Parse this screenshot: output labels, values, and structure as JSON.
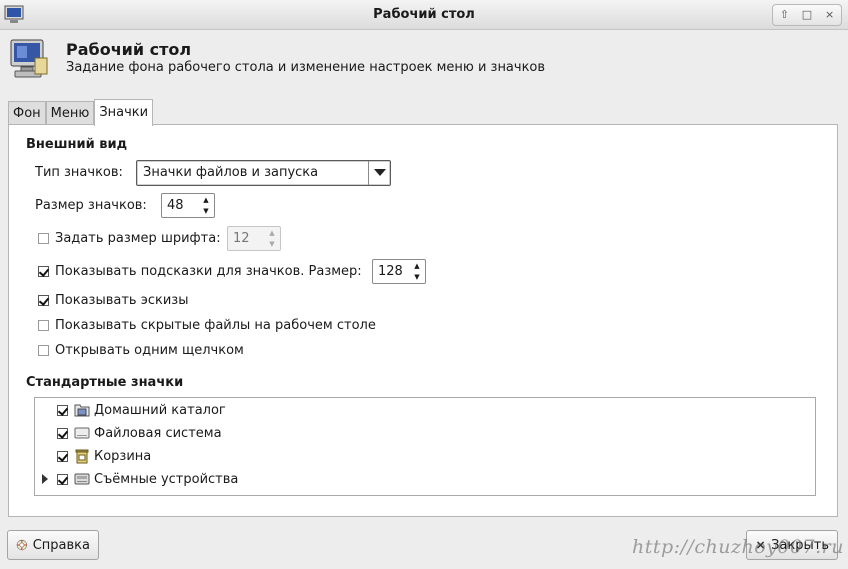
{
  "window": {
    "title": "Рабочий стол",
    "controls": {
      "up": "⇧",
      "restore": "□",
      "close": "×"
    }
  },
  "header": {
    "title": "Рабочий стол",
    "subtitle": "Задание фона рабочего стола и изменение настроек меню и значков",
    "icon": "desktop-monitor-icon"
  },
  "tabs": [
    {
      "label": "Фон",
      "active": false
    },
    {
      "label": "Меню",
      "active": false
    },
    {
      "label": "Значки",
      "active": true
    }
  ],
  "appearance": {
    "section_title": "Внешний вид",
    "icon_type_label": "Тип значков:",
    "icon_type_value": "Значки файлов и запуска",
    "icon_size_label": "Размер значков:",
    "icon_size_value": "48",
    "font_size_label": "Задать размер шрифта:",
    "font_size_checked": false,
    "font_size_value": "12",
    "tooltips_label": "Показывать подсказки для значков. Размер:",
    "tooltips_checked": true,
    "tooltips_size_value": "128",
    "thumbnails_label": "Показывать эскизы",
    "thumbnails_checked": true,
    "hidden_files_label": "Показывать скрытые файлы на рабочем столе",
    "hidden_files_checked": false,
    "single_click_label": "Открывать одним щелчком",
    "single_click_checked": false
  },
  "default_icons": {
    "section_title": "Стандартные значки",
    "items": [
      {
        "label": "Домашний каталог",
        "checked": true,
        "icon": "home-folder-icon",
        "expandable": false
      },
      {
        "label": "Файловая система",
        "checked": true,
        "icon": "drive-icon",
        "expandable": false
      },
      {
        "label": "Корзина",
        "checked": true,
        "icon": "trash-icon",
        "expandable": false
      },
      {
        "label": "Съёмные устройства",
        "checked": true,
        "icon": "removable-drive-icon",
        "expandable": true
      }
    ]
  },
  "buttons": {
    "help_label": "Справка",
    "close_label": "Закрыть"
  },
  "watermark": "http://chuzhoy007.ru"
}
